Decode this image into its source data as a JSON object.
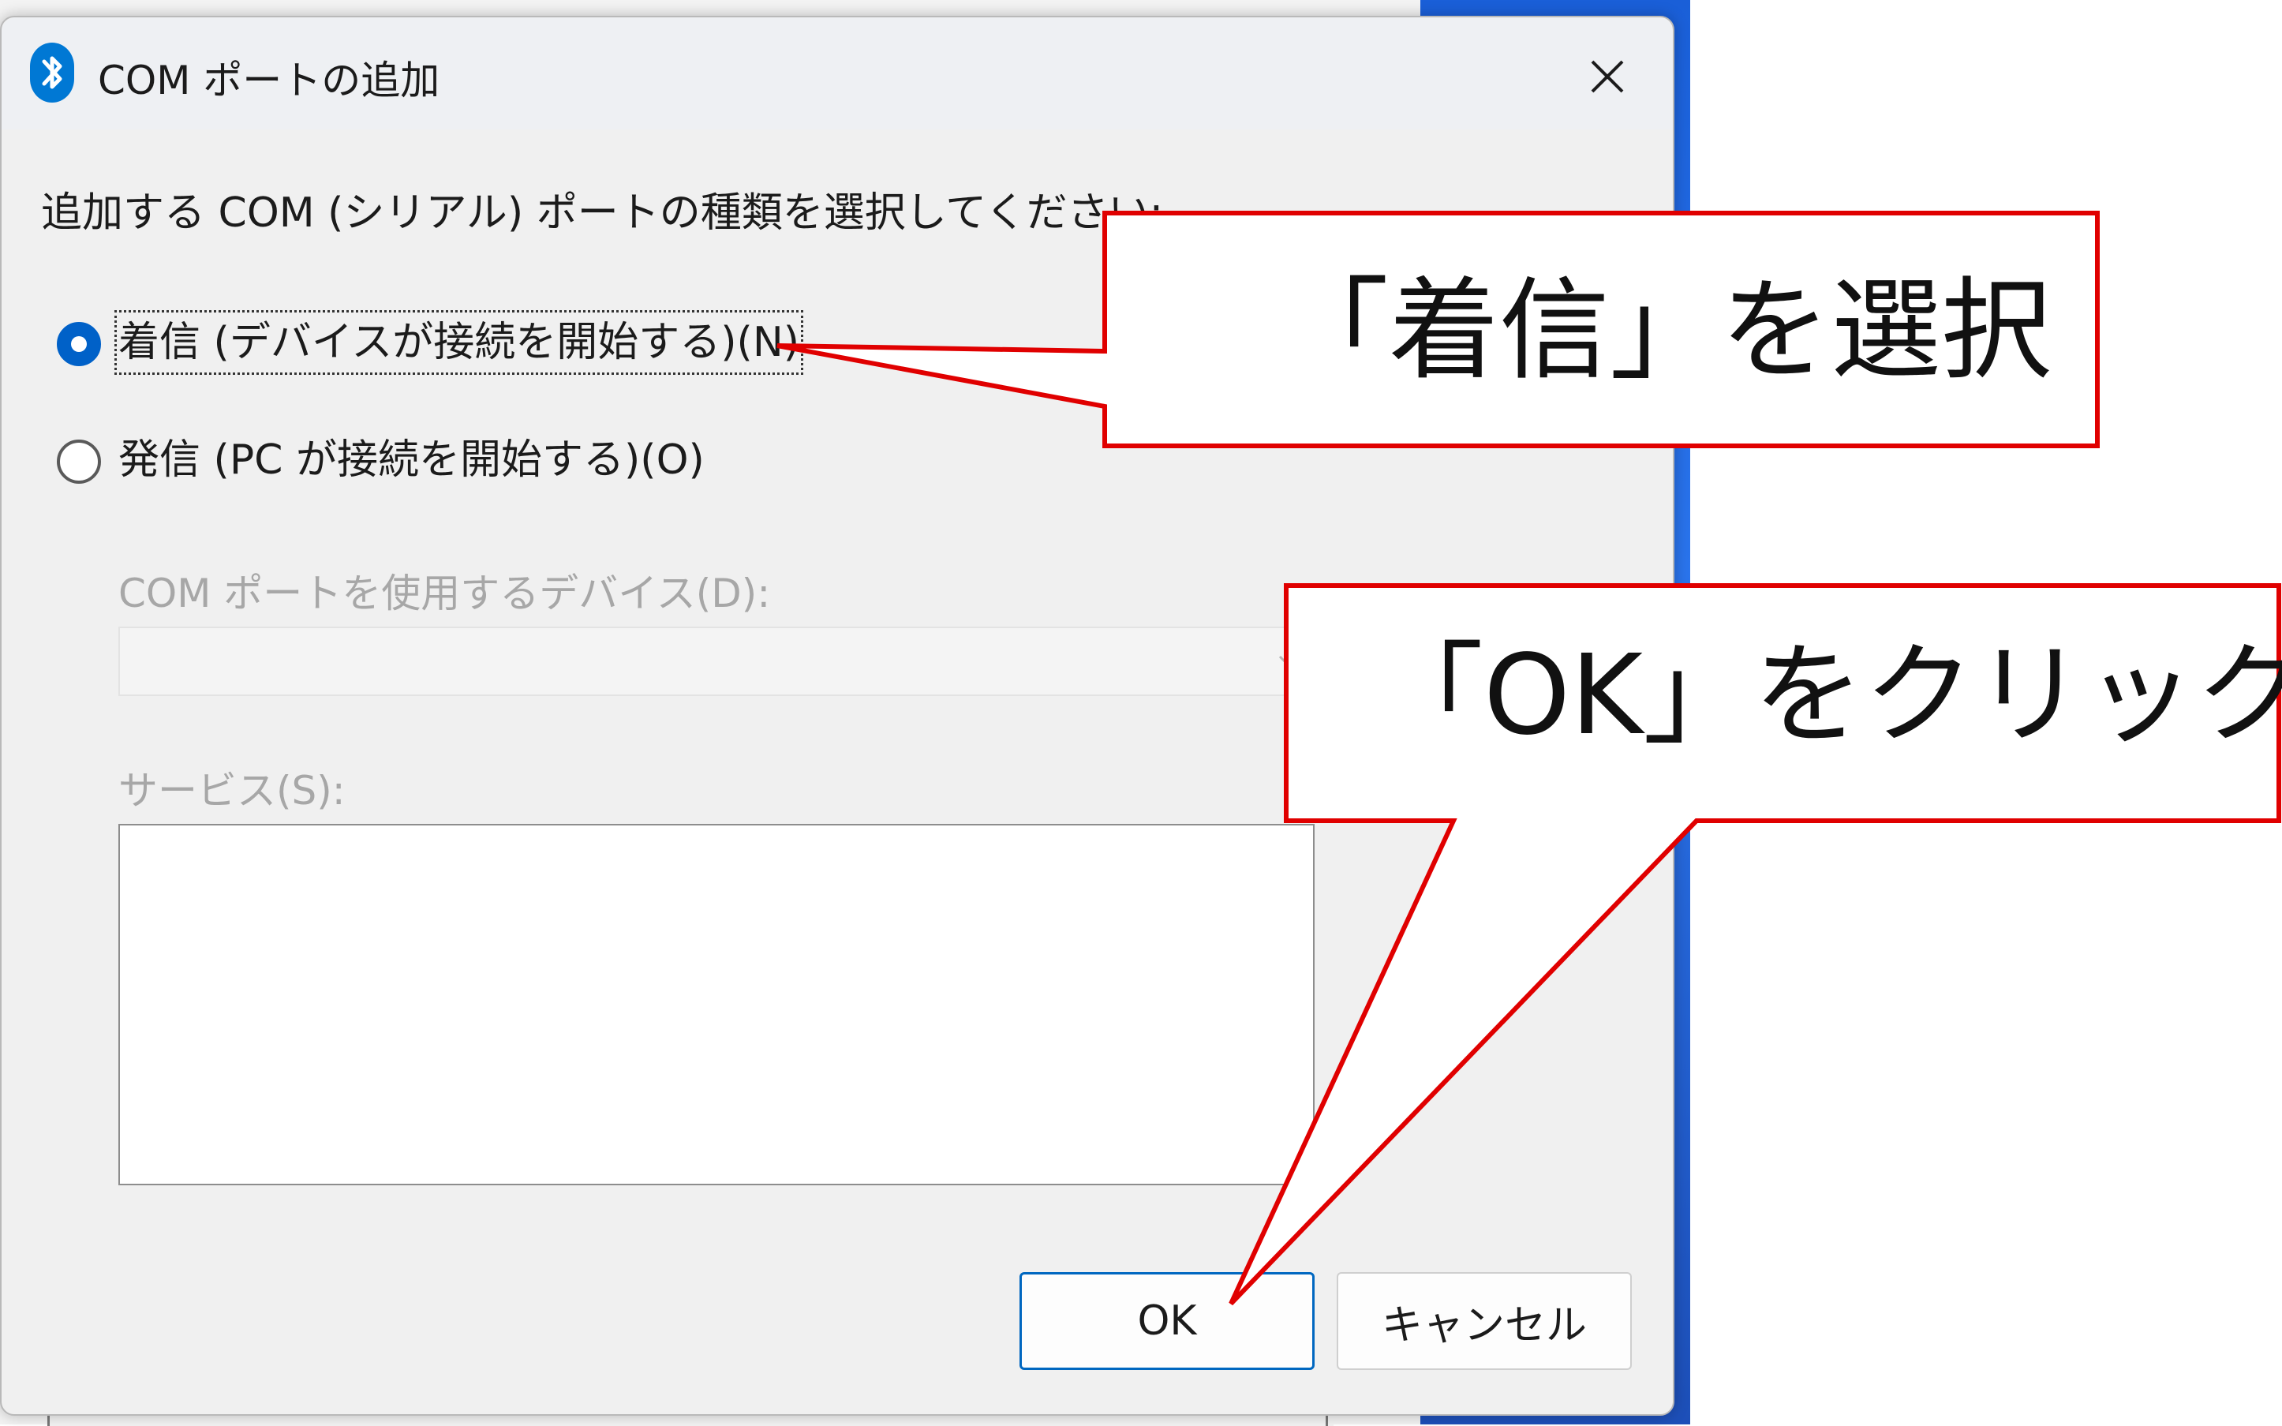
{
  "dialog": {
    "title": "COM ポートの追加",
    "instruction": "追加する COM (シリアル) ポートの種類を選択してください:",
    "options": [
      {
        "label": "着信 (デバイスが接続を開始する)(N)",
        "selected": true
      },
      {
        "label": "発信 (PC が接続を開始する)(O)",
        "selected": false
      }
    ],
    "device_label": "COM ポートを使用するデバイス(D):",
    "service_label": "サービス(S):",
    "ok_label": "OK",
    "cancel_label": "キャンセル"
  },
  "callouts": {
    "select_incoming": "「着信」を選択",
    "click_ok": "「OK」をクリック"
  },
  "icons": {
    "title_icon": "bluetooth-icon",
    "close_icon": "close-icon",
    "dropdown_icon": "chevron-down-icon"
  },
  "colors": {
    "accent": "#0061c8",
    "callout_border": "#e00000",
    "disabled_text": "#a7a7a7"
  }
}
